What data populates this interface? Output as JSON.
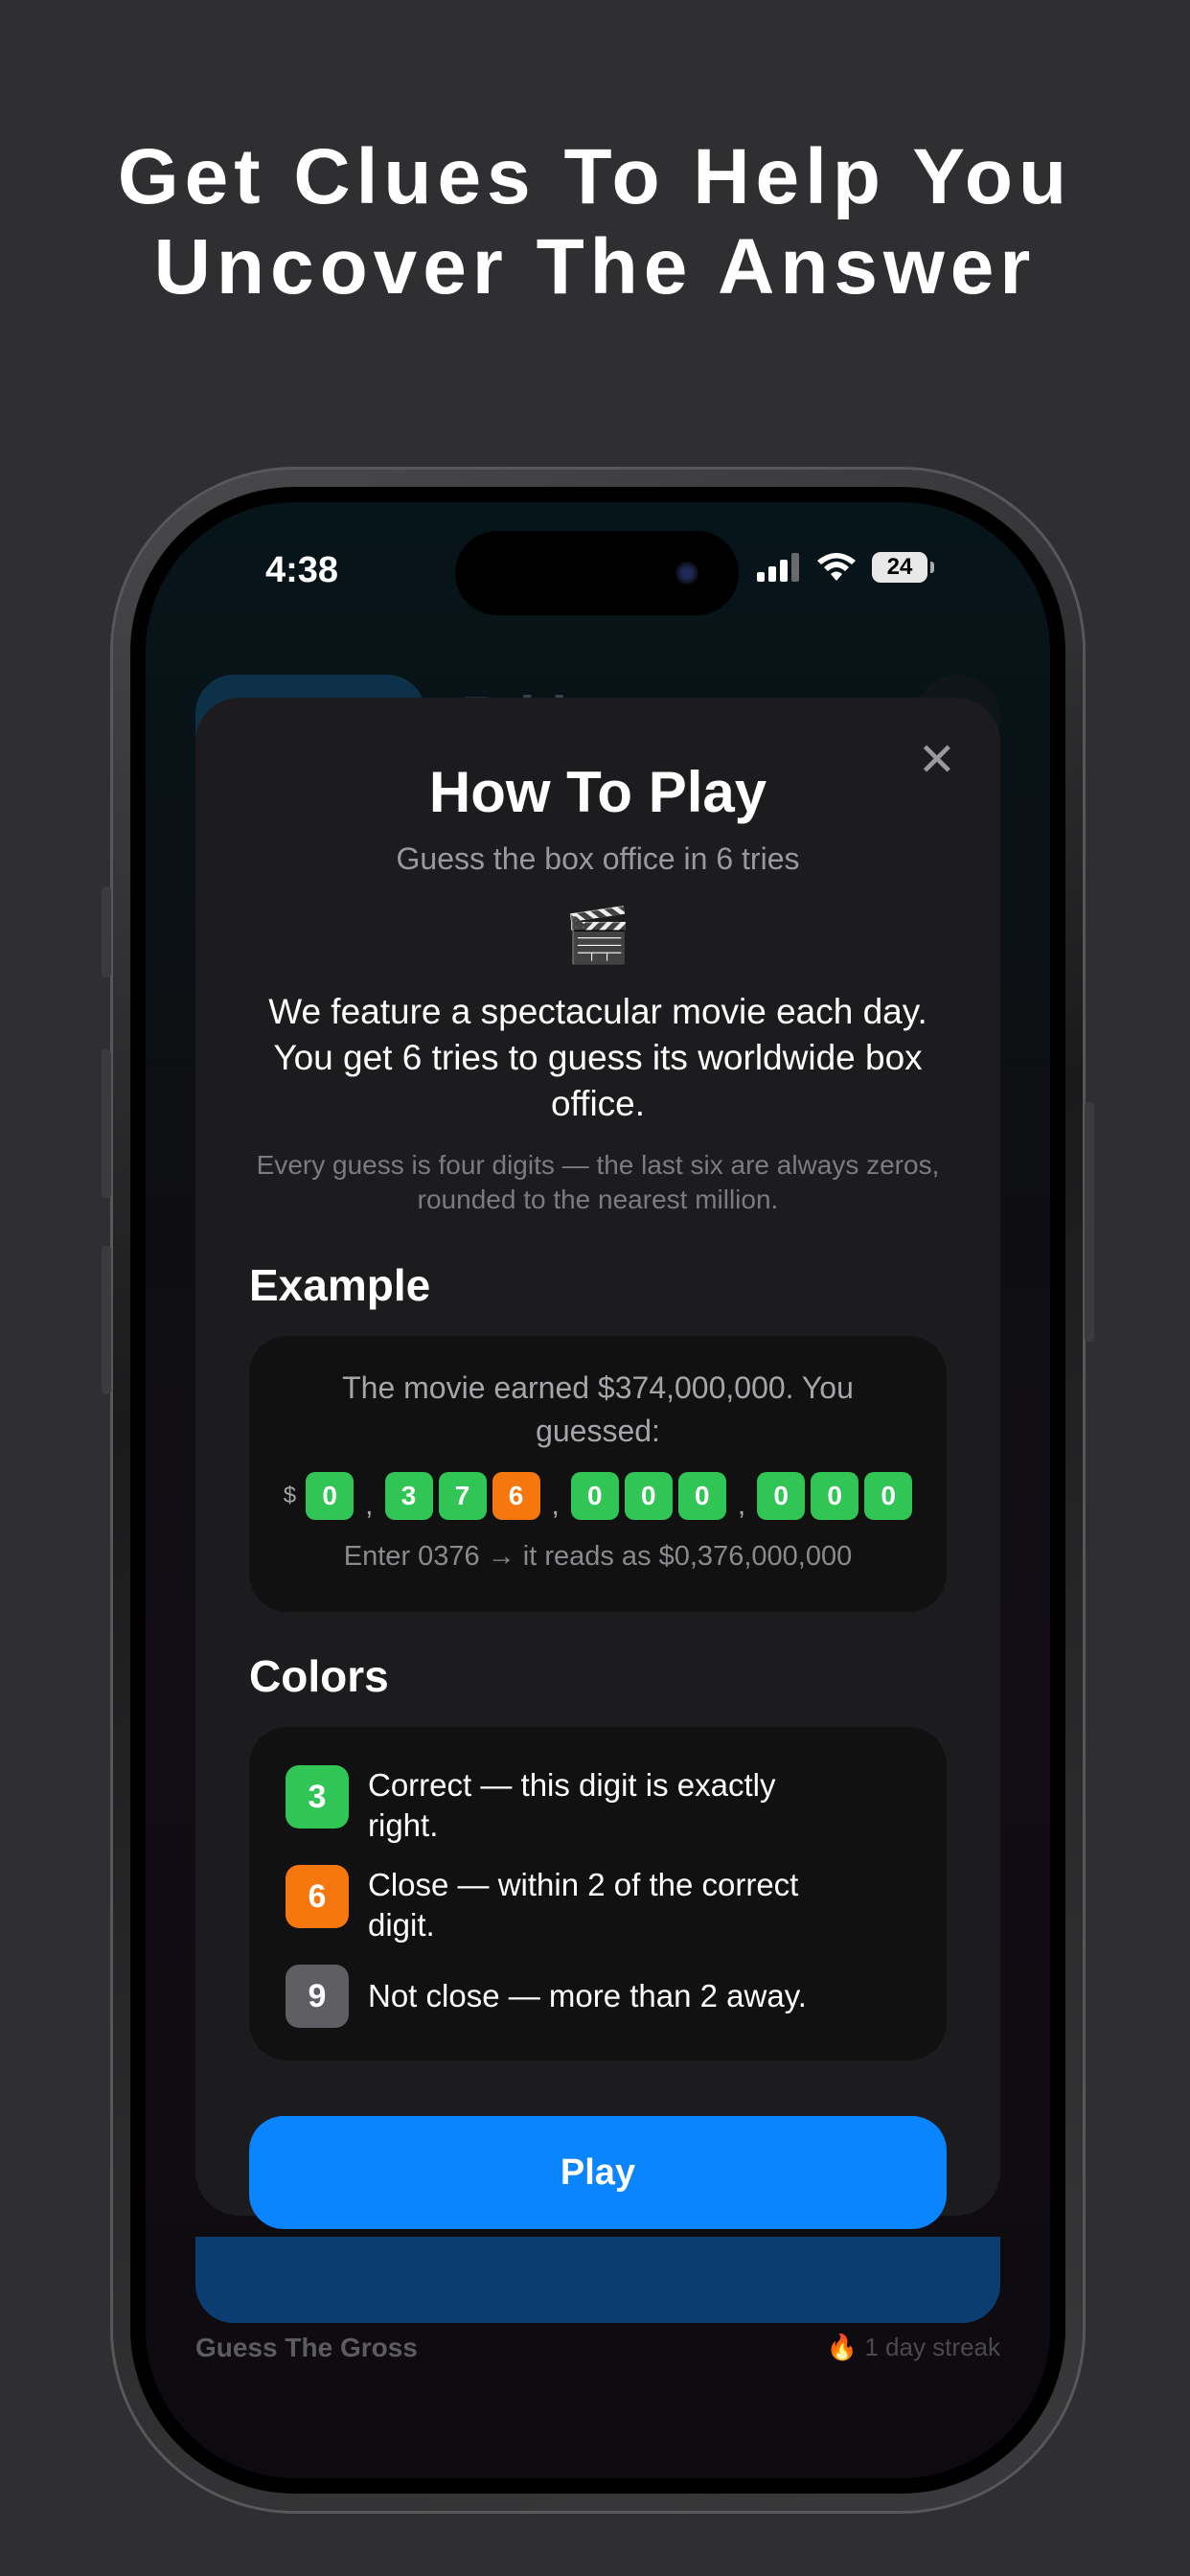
{
  "headline": {
    "line1": "Get Clues To Help You",
    "line2": "Uncover The Answer"
  },
  "status_bar": {
    "time": "4:38",
    "battery": "24",
    "icons": [
      "signal-icon",
      "wifi-icon",
      "battery-icon"
    ]
  },
  "background": {
    "title_partial": "B   l   i",
    "footer_app": "Guess The Gross",
    "streak_icon": "fire-icon",
    "streak": "1 day streak"
  },
  "modal": {
    "title": "How To Play",
    "subtitle": "Guess the box office in 6 tries",
    "icon": "clapperboard-icon",
    "icon_glyph": "🎬",
    "description": "We feature a spectacular movie each day. You get 6 tries to guess its worldwide box office.",
    "note": "Every guess is four digits — the last six are always zeros, rounded to the nearest million.",
    "example": {
      "heading": "Example",
      "line1": "The movie earned $374,000,000. You",
      "line2": "guessed:",
      "currency": "$",
      "digits": [
        {
          "d": "0",
          "state": "green"
        },
        {
          "d": "3",
          "state": "green"
        },
        {
          "d": "7",
          "state": "green"
        },
        {
          "d": "6",
          "state": "orange"
        },
        {
          "d": "0",
          "state": "green"
        },
        {
          "d": "0",
          "state": "green"
        },
        {
          "d": "0",
          "state": "green"
        },
        {
          "d": "0",
          "state": "green"
        },
        {
          "d": "0",
          "state": "green"
        },
        {
          "d": "0",
          "state": "green"
        }
      ],
      "enter_text": "Enter 0376 → it reads as $0,376,000,000"
    },
    "colors": {
      "heading": "Colors",
      "items": [
        {
          "digit": "3",
          "color": "#30c554",
          "line1": "Correct — this digit is exactly",
          "line2": "right."
        },
        {
          "digit": "6",
          "color": "#f7770f",
          "line1": "Close — within 2 of the correct",
          "line2": "digit."
        },
        {
          "digit": "9",
          "color": "#5f5f63",
          "line1": "Not close — more than 2 away.",
          "line2": ""
        }
      ]
    },
    "play_label": "Play"
  },
  "accent_colors": {
    "correct": "#30c554",
    "close": "#f7770f",
    "not_close": "#5f5f63",
    "primary": "#0a84ff"
  }
}
